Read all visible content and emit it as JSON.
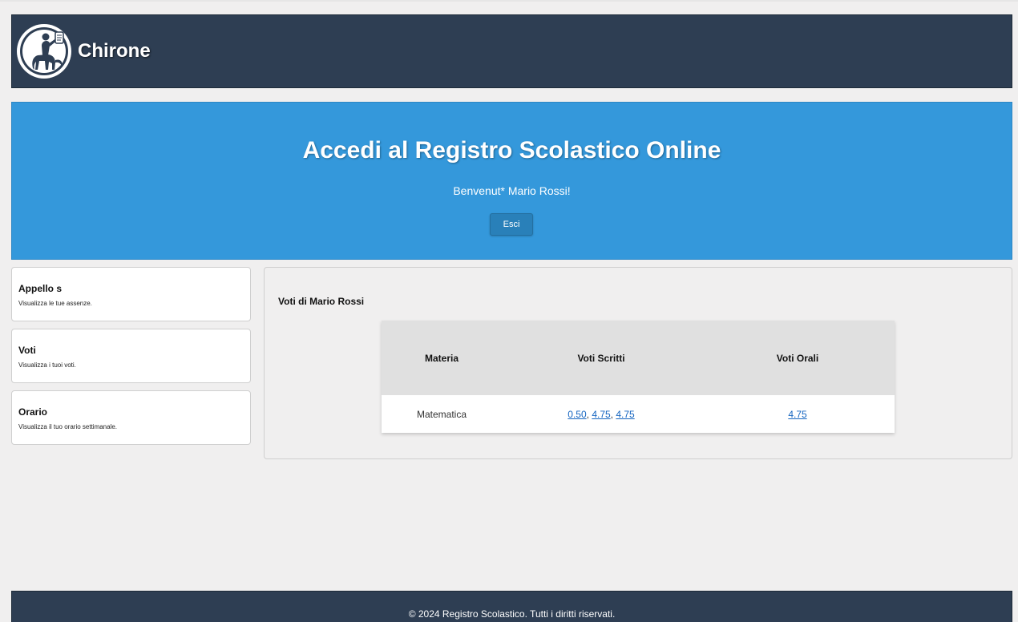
{
  "header": {
    "brand": "Chirone",
    "logo_icon": "centaur-logo-icon"
  },
  "hero": {
    "title": "Accedi al Registro Scolastico Online",
    "welcome": "Benvenut* Mario Rossi!",
    "logout_label": "Esci"
  },
  "sidebar": {
    "items": [
      {
        "title": "Appello s",
        "description": "Visualizza le tue assenze."
      },
      {
        "title": "Voti",
        "description": "Visualizza i tuoi voti."
      },
      {
        "title": "Orario",
        "description": "Visualizza il tuo orario settimanale."
      }
    ]
  },
  "main": {
    "title": "Voti di Mario Rossi",
    "table": {
      "headers": [
        "Materia",
        "Voti Scritti",
        "Voti Orali"
      ],
      "rows": [
        {
          "subject": "Matematica",
          "written": [
            "0.50",
            "4.75",
            "4.75"
          ],
          "oral": [
            "4.75"
          ]
        }
      ],
      "separator": ", "
    }
  },
  "footer": {
    "text": "© 2024 Registro Scolastico. Tutti i diritti riservati."
  },
  "colors": {
    "header_bg": "#2e3e53",
    "hero_bg": "#3498db",
    "button_bg": "#2980b9",
    "link": "#1565c0"
  }
}
